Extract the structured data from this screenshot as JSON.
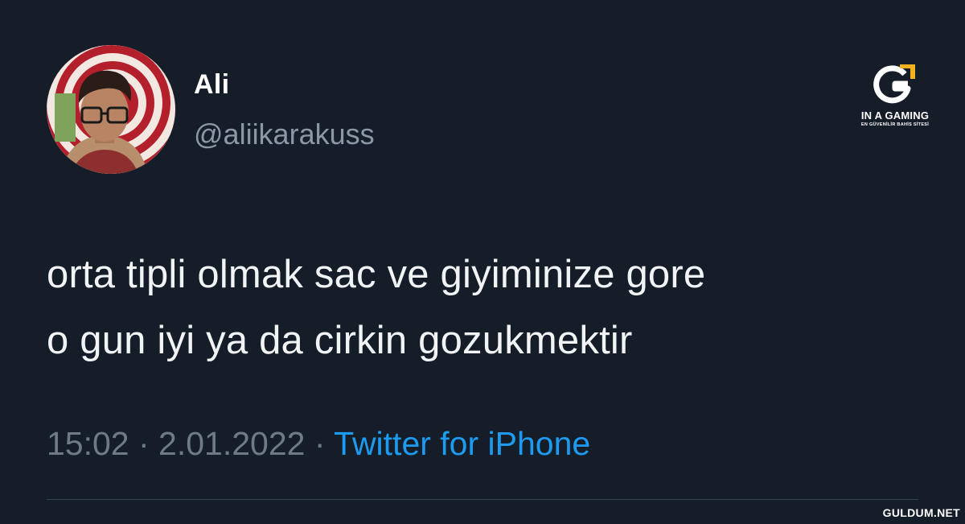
{
  "tweet": {
    "display_name": "Ali",
    "handle": "@aliikarakuss",
    "text": "orta tipli olmak sac ve giyiminize gore\no gun iyi ya da cirkin gozukmektir",
    "time": "15:02",
    "separator": " · ",
    "date": "2.01.2022",
    "source": "Twitter for iPhone",
    "avatar_icon": "profile-photo"
  },
  "overlay": {
    "brand_name": "IN A GAMING",
    "brand_tagline": "EN GÜVENİLİR BAHİS SİTESİ",
    "brand_icon": "g-logo-icon",
    "watermark": "GULDUM.NET"
  },
  "colors": {
    "background": "#151d28",
    "text": "#f1f3f4",
    "muted": "#6e7b87",
    "link": "#1d9bf0",
    "brand_accent": "#f2b21b"
  }
}
